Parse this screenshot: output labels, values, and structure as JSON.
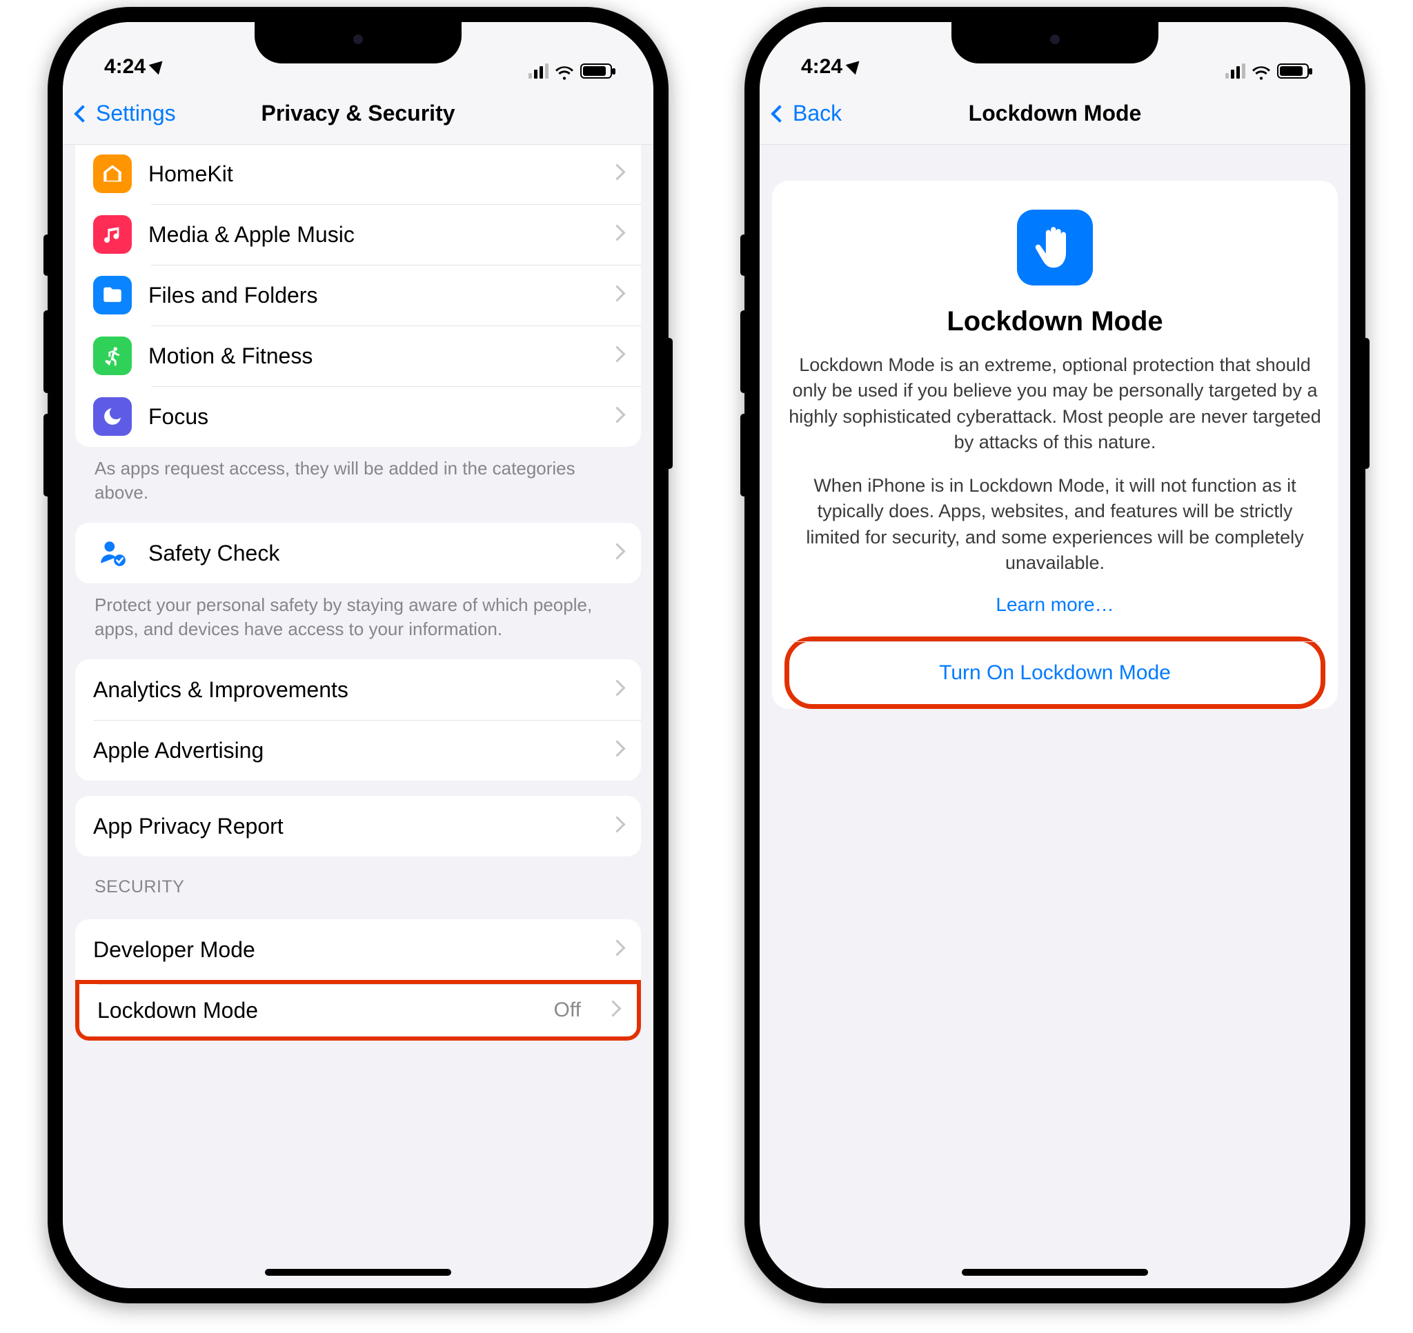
{
  "status": {
    "time": "4:24"
  },
  "left_phone": {
    "back_label": "Settings",
    "title": "Privacy & Security",
    "group1": [
      {
        "label": "HomeKit"
      },
      {
        "label": "Media & Apple Music"
      },
      {
        "label": "Files and Folders"
      },
      {
        "label": "Motion & Fitness"
      },
      {
        "label": "Focus"
      }
    ],
    "group1_footer": "As apps request access, they will be added in the categories above.",
    "safety_check": "Safety Check",
    "safety_footer": "Protect your personal safety by staying aware of which people, apps, and devices have access to your information.",
    "group3": [
      {
        "label": "Analytics & Improvements"
      },
      {
        "label": "Apple Advertising"
      }
    ],
    "app_privacy": "App Privacy Report",
    "security_header": "SECURITY",
    "developer_mode": "Developer Mode",
    "lockdown_mode": {
      "label": "Lockdown Mode",
      "value": "Off"
    }
  },
  "right_phone": {
    "back_label": "Back",
    "title": "Lockdown Mode",
    "card_title": "Lockdown Mode",
    "p1": "Lockdown Mode is an extreme, optional protection that should only be used if you believe you may be personally targeted by a highly sophisticated cyberattack. Most people are never targeted by attacks of this nature.",
    "p2": "When iPhone is in Lockdown Mode, it will not function as it typically does. Apps, websites, and features will be strictly limited for security, and some experiences will be completely unavailable.",
    "learn_more": "Learn more…",
    "turn_on": "Turn On Lockdown Mode"
  }
}
